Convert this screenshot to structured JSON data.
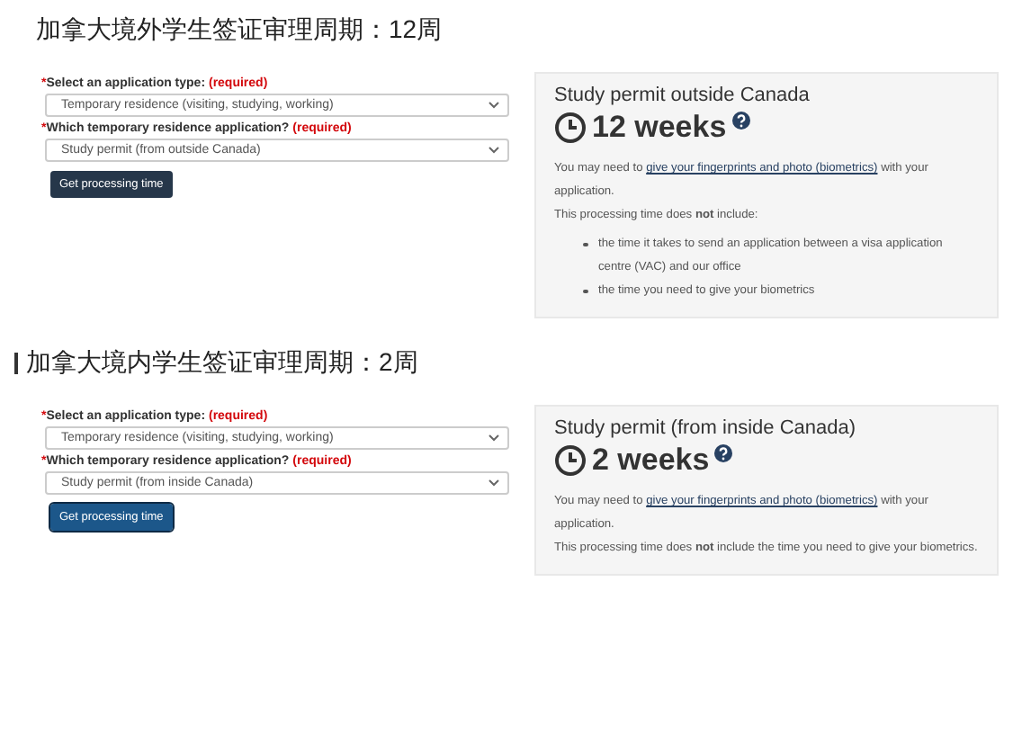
{
  "sections": [
    {
      "heading": "加拿大境外学生签证审理周期：12周",
      "marker": false,
      "form": {
        "fields": [
          {
            "star": "*",
            "label": "Select an application type:",
            "required": "(required)",
            "value": "Temporary residence (visiting, studying, working)"
          },
          {
            "star": "*",
            "label": "Which temporary residence application?",
            "required": "(required)",
            "value": "Study permit (from outside Canada)"
          }
        ],
        "button": {
          "label": "Get processing time",
          "focused": false
        }
      },
      "card": {
        "title": "Study permit outside Canada",
        "duration": "12 weeks",
        "biometrics": {
          "before": "You may need to ",
          "link": "give your fingerprints and photo (biometrics)",
          "after": " with your application."
        },
        "note": "This processing time does **not** include:",
        "bullets": [
          "the time it takes to send an application between a visa application centre (VAC) and our office",
          "the time you need to give your biometrics"
        ]
      }
    },
    {
      "heading": "加拿大境内学生签证审理周期：2周",
      "marker": true,
      "form": {
        "fields": [
          {
            "star": "*",
            "label": "Select an application type:",
            "required": "(required)",
            "value": "Temporary residence (visiting, studying, working)"
          },
          {
            "star": "*",
            "label": "Which temporary residence application?",
            "required": "(required)",
            "value": "Study permit (from inside Canada)"
          }
        ],
        "button": {
          "label": "Get processing time",
          "focused": true
        }
      },
      "card": {
        "title": "Study permit (from inside Canada)",
        "duration": "2 weeks",
        "biometrics": {
          "before": "You may need to ",
          "link": "give your fingerprints and photo (biometrics)",
          "after": " with your application."
        },
        "note": "This processing time does **not** include the time you need to give your biometrics."
      }
    }
  ]
}
